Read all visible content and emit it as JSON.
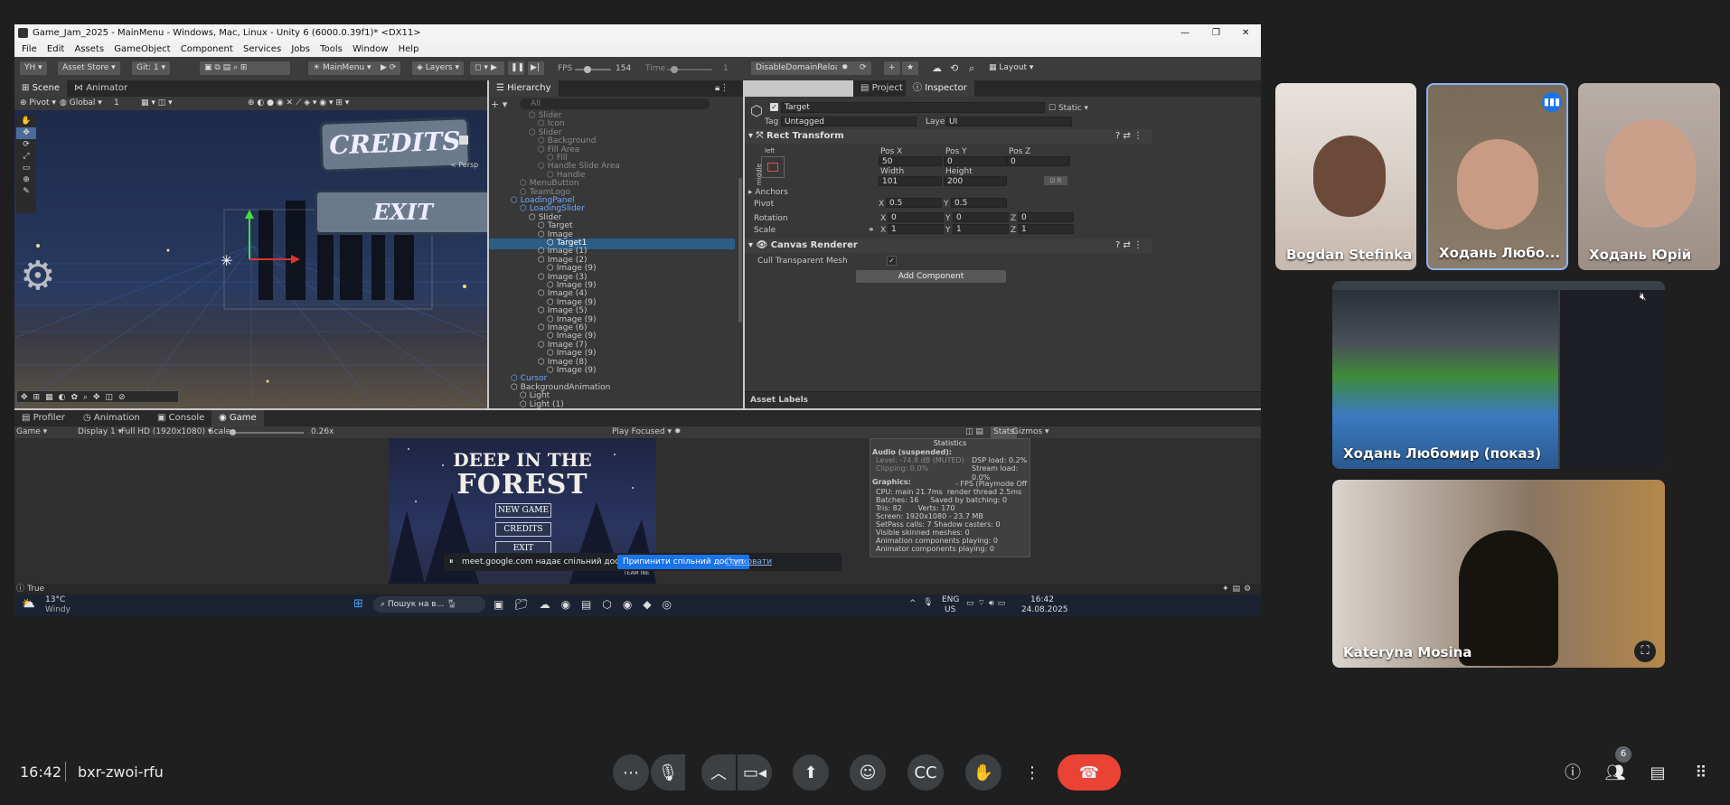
{
  "unity": {
    "window_title": "Game_Jam_2025 - MainMenu - Windows, Mac, Linux - Unity 6 (6000.0.39f1)* <DX11>",
    "menu": [
      "File",
      "Edit",
      "Assets",
      "GameObject",
      "Component",
      "Services",
      "Jobs",
      "Tools",
      "Window",
      "Help"
    ],
    "toolbar": {
      "account": "YH",
      "asset_store": "Asset Store",
      "git": "Git: 1",
      "scene_name": "MainMenu",
      "layers": "Layers",
      "fps_label": "FPS",
      "fps_value": "154",
      "time_label": "Time",
      "time_value": "1",
      "domain_reload": "DisableDomainReload",
      "layout": "Layout"
    },
    "scene": {
      "tabs": [
        "Scene",
        "Animator"
      ],
      "pivot": "Pivot",
      "global": "Global",
      "grid_value": "1",
      "credits_sign": "CREDITS",
      "exit_sign": "EXIT",
      "persp": "< Persp"
    },
    "hierarchy": {
      "tab": "Hierarchy",
      "search_placeholder": "All",
      "rows": [
        {
          "label": "Slider",
          "indent": 3,
          "style": "dim"
        },
        {
          "label": "Icon",
          "indent": 4,
          "style": "dim"
        },
        {
          "label": "Slider",
          "indent": 3,
          "style": "dim"
        },
        {
          "label": "Background",
          "indent": 4,
          "style": "dim"
        },
        {
          "label": "Fill Area",
          "indent": 4,
          "style": "dim"
        },
        {
          "label": "Fill",
          "indent": 5,
          "style": "dim"
        },
        {
          "label": "Handle Slide Area",
          "indent": 4,
          "style": "dim"
        },
        {
          "label": "Handle",
          "indent": 5,
          "style": "dim"
        },
        {
          "label": "MenuButton",
          "indent": 2,
          "style": "dim"
        },
        {
          "label": "TeamLogo",
          "indent": 2,
          "style": "dim"
        },
        {
          "label": "LoadingPanel",
          "indent": 1,
          "style": "blue"
        },
        {
          "label": "LoadingSlider",
          "indent": 2,
          "style": "blue"
        },
        {
          "label": "Slider",
          "indent": 3,
          "style": ""
        },
        {
          "label": "Target",
          "indent": 4,
          "style": ""
        },
        {
          "label": "Image",
          "indent": 4,
          "style": ""
        },
        {
          "label": "Target1",
          "indent": 5,
          "style": "sel"
        },
        {
          "label": "Image (1)",
          "indent": 4,
          "style": ""
        },
        {
          "label": "Image (2)",
          "indent": 4,
          "style": ""
        },
        {
          "label": "Image (9)",
          "indent": 5,
          "style": ""
        },
        {
          "label": "Image (3)",
          "indent": 4,
          "style": ""
        },
        {
          "label": "Image (9)",
          "indent": 5,
          "style": ""
        },
        {
          "label": "Image (4)",
          "indent": 4,
          "style": ""
        },
        {
          "label": "Image (9)",
          "indent": 5,
          "style": ""
        },
        {
          "label": "Image (5)",
          "indent": 4,
          "style": ""
        },
        {
          "label": "Image (9)",
          "indent": 5,
          "style": ""
        },
        {
          "label": "Image (6)",
          "indent": 4,
          "style": ""
        },
        {
          "label": "Image (9)",
          "indent": 5,
          "style": ""
        },
        {
          "label": "Image (7)",
          "indent": 4,
          "style": ""
        },
        {
          "label": "Image (9)",
          "indent": 5,
          "style": ""
        },
        {
          "label": "Image (8)",
          "indent": 4,
          "style": ""
        },
        {
          "label": "Image (9)",
          "indent": 5,
          "style": ""
        },
        {
          "label": "Cursor",
          "indent": 1,
          "style": "blue"
        },
        {
          "label": "BackgroundAnimation",
          "indent": 1,
          "style": ""
        },
        {
          "label": "Light",
          "indent": 2,
          "style": ""
        },
        {
          "label": "Light (1)",
          "indent": 2,
          "style": ""
        }
      ]
    },
    "inspector": {
      "tabs": [
        "Project",
        "Inspector"
      ],
      "object_name": "Target",
      "static_label": "Static",
      "tag_label": "Tag",
      "tag_value": "Untagged",
      "layer_label": "Layer",
      "layer_value": "UI",
      "rect_transform": "Rect Transform",
      "anchor_preset_top": "left",
      "anchor_preset_side": "middle",
      "pos_x_label": "Pos X",
      "pos_x": "50",
      "pos_y_label": "Pos Y",
      "pos_y": "0",
      "pos_z_label": "Pos Z",
      "pos_z": "0",
      "width_label": "Width",
      "width": "101",
      "height_label": "Height",
      "height": "200",
      "anchors": "Anchors",
      "pivot_label": "Pivot",
      "pivot_x": "0.5",
      "pivot_y": "0.5",
      "rotation_label": "Rotation",
      "rot_x": "0",
      "rot_y": "0",
      "rot_z": "0",
      "scale_label": "Scale",
      "scale_x": "1",
      "scale_y": "1",
      "scale_z": "1",
      "axis_x": "X",
      "axis_y": "Y",
      "axis_z": "Z",
      "canvas_renderer": "Canvas Renderer",
      "cull_label": "Cull Transparent Mesh",
      "add_component": "Add Component",
      "asset_labels": "Asset Labels"
    },
    "bottom_tabs": [
      "Profiler",
      "Animation",
      "Console",
      "Game"
    ],
    "game_bar": {
      "view": "Game",
      "display": "Display 1",
      "resolution": "Full HD (1920x1080)",
      "scale_label": "Scale",
      "scale_value": "0.26x",
      "play_focused": "Play Focused",
      "stats": "Stats",
      "gizmos": "Gizmos"
    },
    "game": {
      "title_1": "DEEP IN THE",
      "title_2": "FOREST",
      "new_game": "NEW GAME",
      "credits": "CREDITS",
      "exit": "EXIT",
      "team": "TEAM INE"
    },
    "stats": {
      "title": "Statistics",
      "audio_head": "Audio (suspended):",
      "level": "Level: -74.8 dB (MUTED)",
      "clipping": "Clipping: 0.0%",
      "dsp": "DSP load: 0.2%",
      "stream": "Stream load: 0.0%",
      "graphics_head": "Graphics:",
      "fps_mode": "- FPS (Playmode Off",
      "cpu": "CPU: main 21.7ms  render thread 2.5ms",
      "batches": "Batches: 16     Saved by batching: 0",
      "tris": "Tris: 82       Verts: 170",
      "screen": "Screen: 1920x1080 - 23.7 MB",
      "setpass": "SetPass calls: 7  Shadow casters: 0",
      "skinned": "Visible skinned meshes: 0",
      "anim": "Animation components playing: 0",
      "animator": "Animator components playing: 0"
    },
    "status_text": "True",
    "share_banner": {
      "text": "meet.google.com надає спільний доступ до екрана.",
      "stop": "Припинити спільний доступ",
      "hide": "Приховати"
    }
  },
  "windows_taskbar": {
    "temp": "13°C",
    "weather": "Windy",
    "search_placeholder": "Пошук на в...",
    "lang": "ENG",
    "lang2": "US",
    "time": "16:42",
    "date": "24.08.2025"
  },
  "participants": [
    {
      "name": "Bogdan Stefinka"
    },
    {
      "name": "Ходань Любо..."
    },
    {
      "name": "Ходань Юрій"
    },
    {
      "name": "Ходань Любомир (показ)"
    },
    {
      "name": "Kateryna Mosina"
    }
  ],
  "meet": {
    "clock": "16:42",
    "meeting_code": "bxr-zwoi-rfu",
    "people_count": "6",
    "colors": {
      "end_call": "#ea4335",
      "speaking": "#8ab4f8"
    }
  }
}
